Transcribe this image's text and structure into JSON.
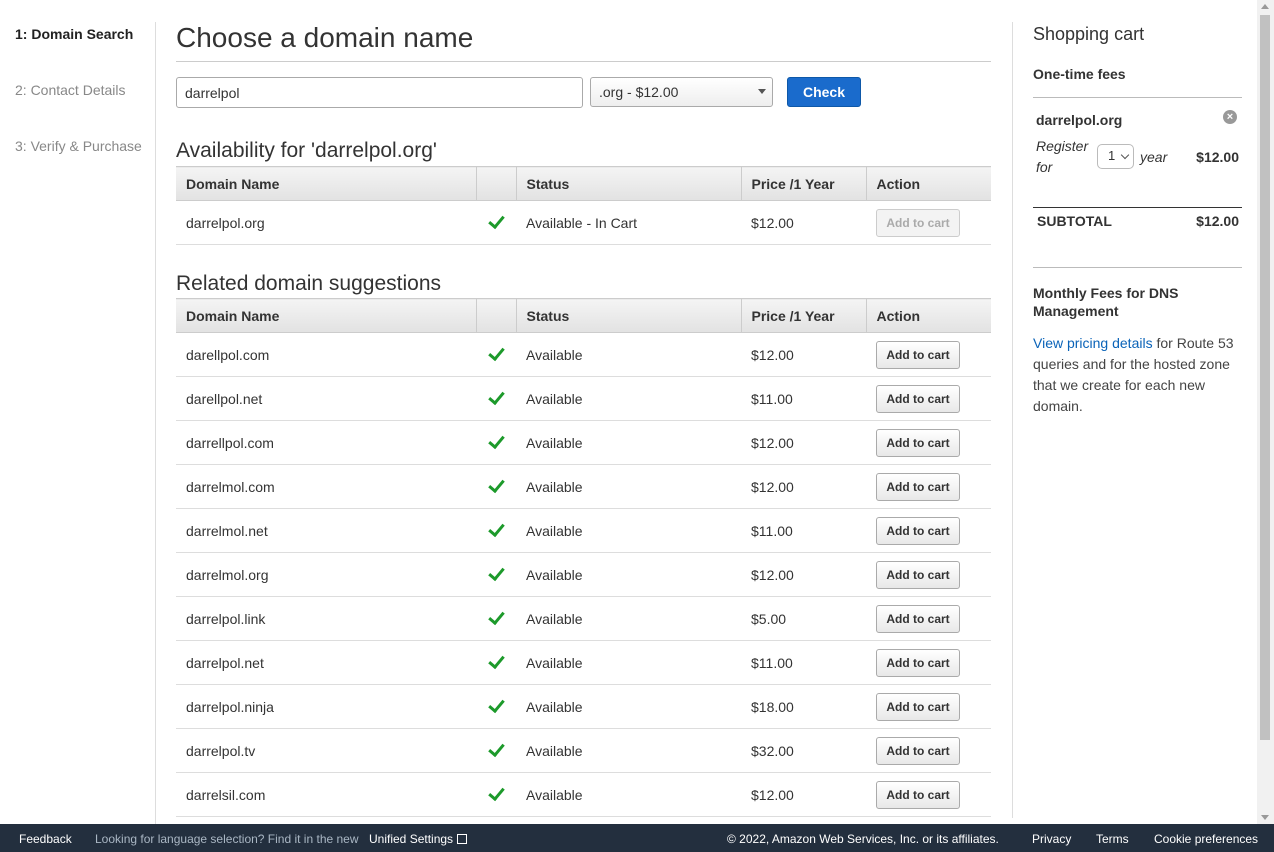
{
  "steps": [
    {
      "label": "1: Domain Search"
    },
    {
      "label": "2: Contact Details"
    },
    {
      "label": "3: Verify & Purchase"
    }
  ],
  "main": {
    "title": "Choose a domain name",
    "search_value": "darrelpol",
    "tld_selected": ".org - $12.00",
    "check_label": "Check"
  },
  "availability": {
    "title": "Availability for 'darrelpol.org'",
    "headers": [
      "Domain Name",
      "",
      "Status",
      "Price /1 Year",
      "Action"
    ],
    "row": {
      "domain": "darrelpol.org",
      "status": "Available - In Cart",
      "price": "$12.00",
      "action": "Add to cart"
    }
  },
  "suggestions": {
    "title": "Related domain suggestions",
    "headers": [
      "Domain Name",
      "",
      "Status",
      "Price /1 Year",
      "Action"
    ],
    "rows": [
      {
        "domain": "darellpol.com",
        "status": "Available",
        "price": "$12.00",
        "action": "Add to cart"
      },
      {
        "domain": "darellpol.net",
        "status": "Available",
        "price": "$11.00",
        "action": "Add to cart"
      },
      {
        "domain": "darrellpol.com",
        "status": "Available",
        "price": "$12.00",
        "action": "Add to cart"
      },
      {
        "domain": "darrelmol.com",
        "status": "Available",
        "price": "$12.00",
        "action": "Add to cart"
      },
      {
        "domain": "darrelmol.net",
        "status": "Available",
        "price": "$11.00",
        "action": "Add to cart"
      },
      {
        "domain": "darrelmol.org",
        "status": "Available",
        "price": "$12.00",
        "action": "Add to cart"
      },
      {
        "domain": "darrelpol.link",
        "status": "Available",
        "price": "$5.00",
        "action": "Add to cart"
      },
      {
        "domain": "darrelpol.net",
        "status": "Available",
        "price": "$11.00",
        "action": "Add to cart"
      },
      {
        "domain": "darrelpol.ninja",
        "status": "Available",
        "price": "$18.00",
        "action": "Add to cart"
      },
      {
        "domain": "darrelpol.tv",
        "status": "Available",
        "price": "$32.00",
        "action": "Add to cart"
      },
      {
        "domain": "darrelsil.com",
        "status": "Available",
        "price": "$12.00",
        "action": "Add to cart"
      }
    ]
  },
  "cart": {
    "title": "Shopping cart",
    "fees_label": "One-time fees",
    "item_name": "darrelpol.org",
    "register_for": "Register for",
    "years": "1",
    "year_word": "year",
    "item_price": "$12.00",
    "subtotal_label": "SUBTOTAL",
    "subtotal_value": "$12.00",
    "dns_title": "Monthly Fees for DNS Management",
    "dns_link": "View pricing details",
    "dns_text": " for Route 53 queries and for the hosted zone that we create for each new domain."
  },
  "footer": {
    "feedback": "Feedback",
    "language_prompt": "Looking for language selection? Find it in the new",
    "unified_settings": "Unified Settings",
    "copyright": "© 2022, Amazon Web Services, Inc. or its affiliates.",
    "privacy": "Privacy",
    "terms": "Terms",
    "cookies": "Cookie preferences"
  },
  "colors": {
    "primary_button": "#1a6bcc",
    "check_green": "#1d9a2b",
    "link": "#0a63b8",
    "footer_bg": "#232f3e"
  }
}
